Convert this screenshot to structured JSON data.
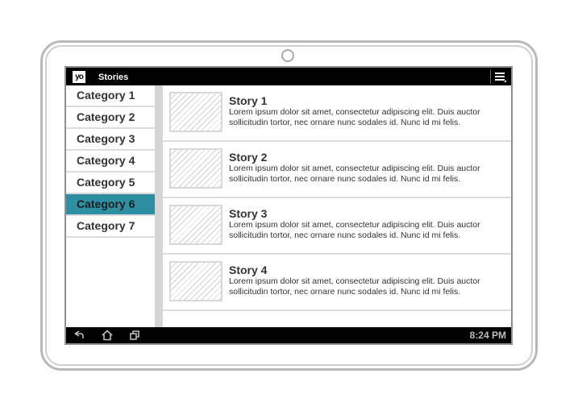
{
  "app": {
    "logo_text": "yo",
    "title": "Stories"
  },
  "icons": {
    "menu": "overflow-menu-icon",
    "back": "back-arrow-icon",
    "home": "home-icon",
    "recents": "recent-apps-icon"
  },
  "colors": {
    "selected_category": "#2e8fa3",
    "bars": "#000000"
  },
  "sidebar": {
    "selected_index": 5,
    "categories": [
      {
        "label": "Category 1"
      },
      {
        "label": "Category 2"
      },
      {
        "label": "Category 3"
      },
      {
        "label": "Category 4"
      },
      {
        "label": "Category 5"
      },
      {
        "label": "Category 6"
      },
      {
        "label": "Category 7"
      }
    ]
  },
  "stories": [
    {
      "title": "Story 1",
      "body": "Lorem ipsum dolor sit amet, consectetur adipiscing elit. Duis auctor sollicitudin tortor, nec ornare nunc sodales id. Nunc id mi felis."
    },
    {
      "title": "Story 2",
      "body": "Lorem ipsum dolor sit amet, consectetur adipiscing elit. Duis auctor sollicitudin tortor, nec ornare nunc sodales id. Nunc id mi felis."
    },
    {
      "title": "Story 3",
      "body": "Lorem ipsum dolor sit amet, consectetur adipiscing elit. Duis auctor sollicitudin tortor, nec ornare nunc sodales id. Nunc id mi felis."
    },
    {
      "title": "Story 4",
      "body": "Lorem ipsum dolor sit amet, consectetur adipiscing elit. Duis auctor sollicitudin tortor, nec ornare nunc sodales id. Nunc id mi felis."
    }
  ],
  "status": {
    "time": "8:24 PM"
  }
}
